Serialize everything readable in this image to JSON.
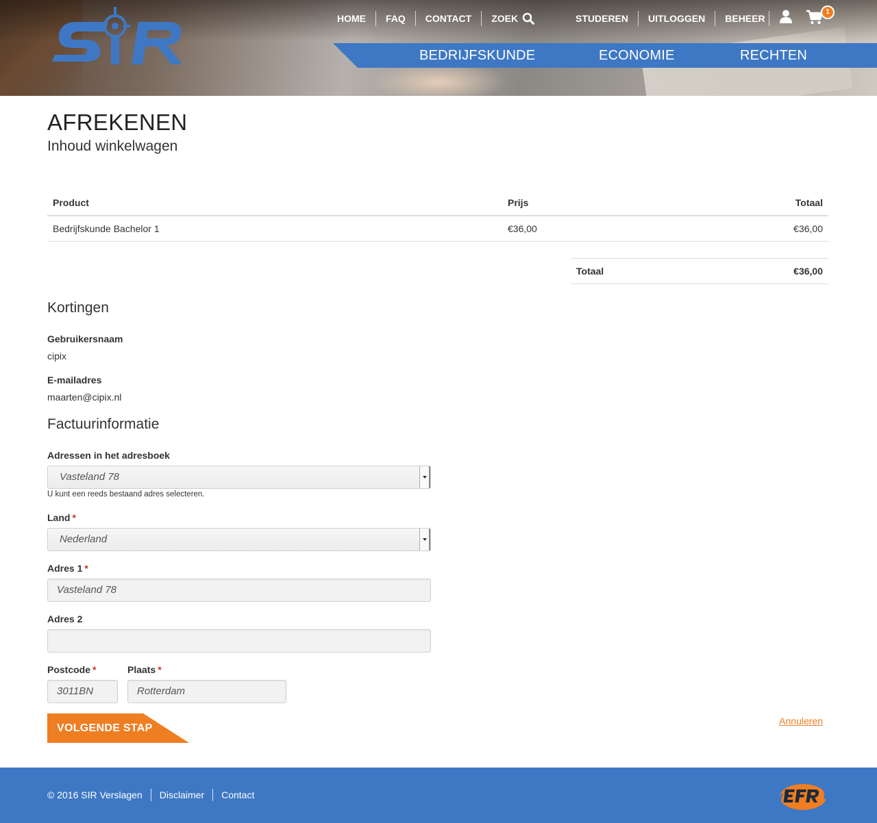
{
  "header": {
    "top_nav_left": [
      "HOME",
      "FAQ",
      "CONTACT",
      "ZOEK"
    ],
    "top_nav_right": [
      "STUDEREN",
      "UITLOGGEN",
      "BEHEER"
    ],
    "cart_count": "1",
    "main_nav": [
      "BEDRIJFSKUNDE",
      "ECONOMIE",
      "RECHTEN"
    ],
    "colors": {
      "brand_blue": "#3e78c4",
      "accent_orange": "#ef7d22"
    }
  },
  "page": {
    "title": "AFREKENEN",
    "subtitle": "Inhoud winkelwagen"
  },
  "cart": {
    "headers": {
      "product": "Product",
      "price": "Prijs",
      "total": "Totaal"
    },
    "rows": [
      {
        "product": "Bedrijfskunde Bachelor 1",
        "price": "€36,00",
        "total": "€36,00"
      }
    ],
    "grand_total_label": "Totaal",
    "grand_total_value": "€36,00"
  },
  "discounts": {
    "title": "Kortingen",
    "username_label": "Gebruikersnaam",
    "username_value": "cipix",
    "email_label": "E-mailadres",
    "email_value": "maarten@cipix.nl"
  },
  "billing": {
    "title": "Factuurinformatie",
    "addressbook_label": "Adressen in het adresboek",
    "addressbook_value": "Vasteland 78",
    "addressbook_help": "U kunt een reeds bestaand adres selecteren.",
    "country_label": "Land",
    "country_value": "Nederland",
    "address1_label": "Adres 1",
    "address1_value": "Vasteland 78",
    "address2_label": "Adres 2",
    "address2_value": "",
    "postcode_label": "Postcode",
    "postcode_value": "3011BN",
    "city_label": "Plaats",
    "city_value": "Rotterdam",
    "required_mark": "*"
  },
  "actions": {
    "next_label": "VOLGENDE STAP",
    "cancel_label": "Annuleren"
  },
  "footer": {
    "copyright": "© 2016 SIR Verslagen",
    "disclaimer": "Disclaimer",
    "contact": "Contact"
  }
}
